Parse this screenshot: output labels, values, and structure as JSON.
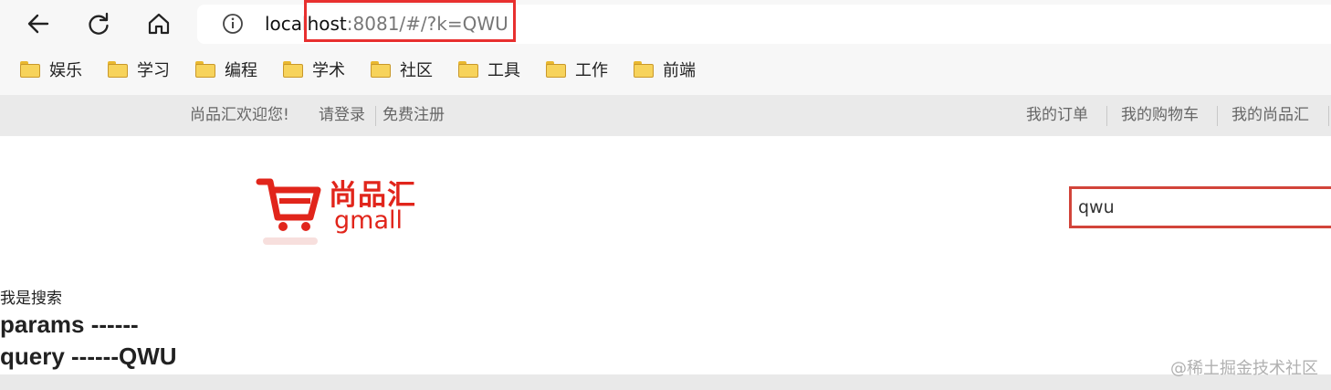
{
  "browser": {
    "url_host": "localhost",
    "url_rest": ":8081/#/?k=QWU",
    "bookmarks": [
      "娱乐",
      "学习",
      "编程",
      "学术",
      "社区",
      "工具",
      "工作",
      "前端"
    ],
    "icons": {
      "back": "back-arrow-icon",
      "reload": "reload-icon",
      "home": "home-icon",
      "info": "info-icon",
      "folder": "folder-icon"
    },
    "highlight_color": "#e8302f"
  },
  "topbar": {
    "welcome": "尚品汇欢迎您!",
    "login": "请登录",
    "register": "免费注册",
    "links": [
      "我的订单",
      "我的购物车",
      "我的尚品汇"
    ]
  },
  "logo": {
    "cn": "尚品汇",
    "en": "gmall",
    "color": "#e1251b"
  },
  "search": {
    "value": "qwu"
  },
  "content": {
    "label": "我是搜索",
    "params_line": "params ------",
    "query_line": "query ------QWU"
  },
  "watermark": "@稀土掘金技术社区"
}
